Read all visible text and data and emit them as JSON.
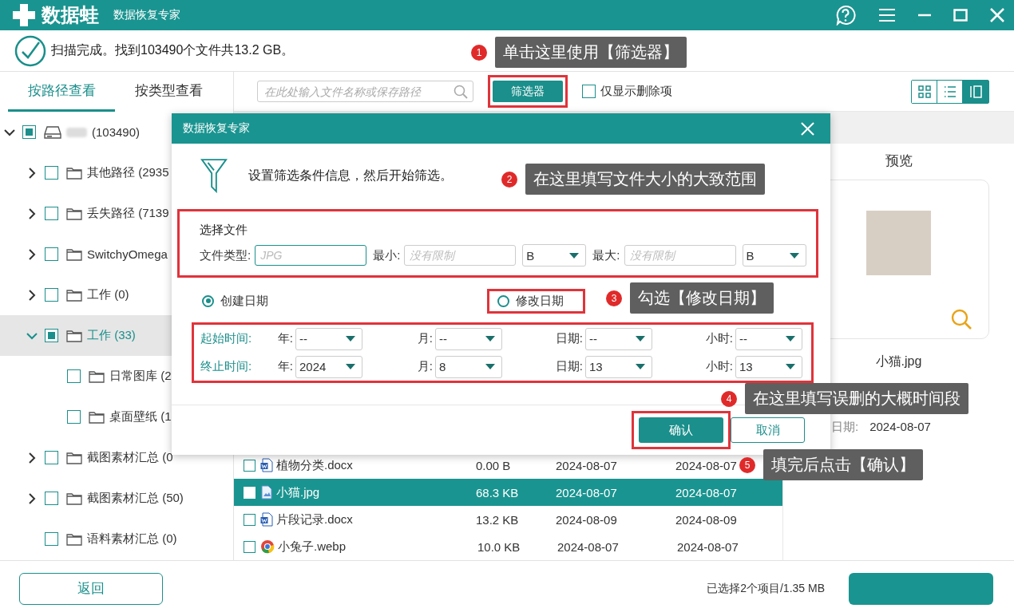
{
  "app": {
    "logo_text": "数据蛙",
    "subtitle": "数据恢复专家"
  },
  "scan_status": "扫描完成。找到103490个文件共13.2 GB。",
  "sidebar": {
    "tabs": [
      {
        "label": "按路径查看",
        "selected": true
      },
      {
        "label": "按类型查看",
        "selected": false
      }
    ],
    "tree": [
      {
        "kind": "drive",
        "label": "(103490)",
        "expanded": true,
        "partial": true,
        "selected": false,
        "children": [
          {
            "kind": "folder",
            "label": "其他路径 (2935",
            "expanded": false,
            "partial": false,
            "selected": false
          },
          {
            "kind": "folder",
            "label": "丢失路径 (7139",
            "expanded": false,
            "partial": false,
            "selected": false
          },
          {
            "kind": "folder",
            "label": "SwitchyOmega",
            "expanded": false,
            "partial": false,
            "selected": false
          },
          {
            "kind": "folder",
            "label": "工作 (0)",
            "expanded": false,
            "partial": false,
            "selected": false
          },
          {
            "kind": "folder",
            "label": "工作 (33)",
            "expanded": true,
            "partial": true,
            "selected": true,
            "children": [
              {
                "kind": "leaf",
                "label": "日常图库 (2",
                "partial": false,
                "selected": false
              },
              {
                "kind": "leaf",
                "label": "桌面壁纸 (1",
                "partial": false,
                "selected": false
              }
            ]
          },
          {
            "kind": "folder",
            "label": "截图素材汇总 (0",
            "expanded": false,
            "partial": false,
            "selected": false
          },
          {
            "kind": "folder",
            "label": "截图素材汇总 (50)",
            "expanded": false,
            "partial": false,
            "selected": false
          },
          {
            "kind": "leaf",
            "label": "语料素材汇总 (0)",
            "partial": false,
            "selected": false
          }
        ]
      }
    ]
  },
  "toolbar": {
    "search": {
      "placeholder": "在此处输入文件名称或保存路径"
    },
    "filter_button": "筛选器",
    "deleted_only": {
      "label": "仅显示删除项",
      "checked": false
    },
    "views": [
      {
        "kind": "grid",
        "selected": false
      },
      {
        "kind": "list",
        "selected": false
      },
      {
        "kind": "detail",
        "selected": true
      }
    ]
  },
  "files": [
    {
      "kind": "word",
      "name": "植物分类.docx",
      "size": "0.00 B",
      "created": "2024-08-07",
      "modified": "2024-08-07",
      "selected": false
    },
    {
      "kind": "image",
      "name": "小猫.jpg",
      "size": "68.3 KB",
      "created": "2024-08-07",
      "modified": "2024-08-07",
      "selected": true
    },
    {
      "kind": "word",
      "name": "片段记录.docx",
      "size": "13.2 KB",
      "created": "2024-08-09",
      "modified": "2024-08-09",
      "selected": false
    },
    {
      "kind": "web",
      "name": "小兔子.webp",
      "size": "10.0 KB",
      "created": "2024-08-07",
      "modified": "2024-08-07",
      "selected": false
    }
  ],
  "preview": {
    "title": "预览",
    "file_name": "小猫.jpg",
    "details": [
      {
        "label": "日期:",
        "value": "2024-08-07"
      }
    ]
  },
  "dialog": {
    "title": "数据恢复专家",
    "intro": "设置筛选条件信息，然后开始筛选。",
    "file_section": {
      "heading": "选择文件",
      "type_label": "文件类型:",
      "type_field": {
        "placeholder": "JPG",
        "focused": true
      },
      "min_label": "最小:",
      "min_field": {
        "placeholder": "没有限制"
      },
      "min_unit": "B",
      "max_label": "最大:",
      "max_field": {
        "placeholder": "没有限制"
      },
      "max_unit": "B"
    },
    "date_modes": [
      {
        "label": "创建日期",
        "selected": true
      },
      {
        "label": "修改日期",
        "selected": false
      }
    ],
    "time_rows": [
      {
        "label": "起始时间:",
        "fields": [
          {
            "label": "年:",
            "value": "--"
          },
          {
            "label": "月:",
            "value": "--"
          },
          {
            "label": "日期:",
            "value": "--"
          },
          {
            "label": "小时:",
            "value": "--"
          }
        ]
      },
      {
        "label": "终止时间:",
        "fields": [
          {
            "label": "年:",
            "value": "2024"
          },
          {
            "label": "月:",
            "value": "8"
          },
          {
            "label": "日期:",
            "value": "13"
          },
          {
            "label": "小时:",
            "value": "13"
          }
        ]
      }
    ],
    "buttons": [
      {
        "kind": "primary",
        "label": "确认"
      },
      {
        "kind": "secondary",
        "label": "取消"
      }
    ]
  },
  "annotations": [
    {
      "number": "1",
      "text": "单击这里使用【筛选器】"
    },
    {
      "number": "2",
      "text": "在这里填写文件大小的大致范围"
    },
    {
      "number": "3",
      "text": "勾选【修改日期】"
    },
    {
      "number": "4",
      "text": "在这里填写误删的大概时间段"
    },
    {
      "number": "5",
      "text": "填完后点击【确认】"
    }
  ],
  "footer": {
    "back_button": "返回",
    "selection": "已选择2个项目/1.35 MB"
  }
}
